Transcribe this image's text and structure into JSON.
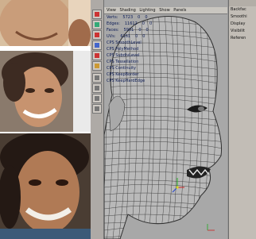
{
  "viewport": {
    "top_menu": [
      "View",
      "Shading",
      "Lighting",
      "Show",
      "Panels"
    ],
    "hud": {
      "rows": [
        {
          "label": "Verts:",
          "value": "5723",
          "value2": "0",
          "value3": "0"
        },
        {
          "label": "Edges:",
          "value": "11612",
          "value2": "0",
          "value3": "0"
        },
        {
          "label": "Faces:",
          "value": "5901",
          "value2": "0",
          "value3": "0"
        },
        {
          "label": "UVs:",
          "value": "6161",
          "value2": "0",
          "value3": "0"
        }
      ],
      "fps_rows": [
        "CPS SmoothLevel",
        "CPS PolyMethod",
        "CPS SubdivLevel",
        "CPS Tessellation",
        "CPS Continuity",
        "CPS KeepBorder",
        "CPS KeepHardEdge"
      ]
    }
  },
  "channel_box": {
    "items": [
      "Backfac",
      "Smoothi",
      "Display",
      "Visibilit",
      "Referen"
    ]
  },
  "colors": {
    "mesh_line": "#3b3b3b",
    "mesh_fill": "#b9b9b9",
    "menu_bg": "#c9c6c0",
    "hud_text": "#0a1a55"
  }
}
